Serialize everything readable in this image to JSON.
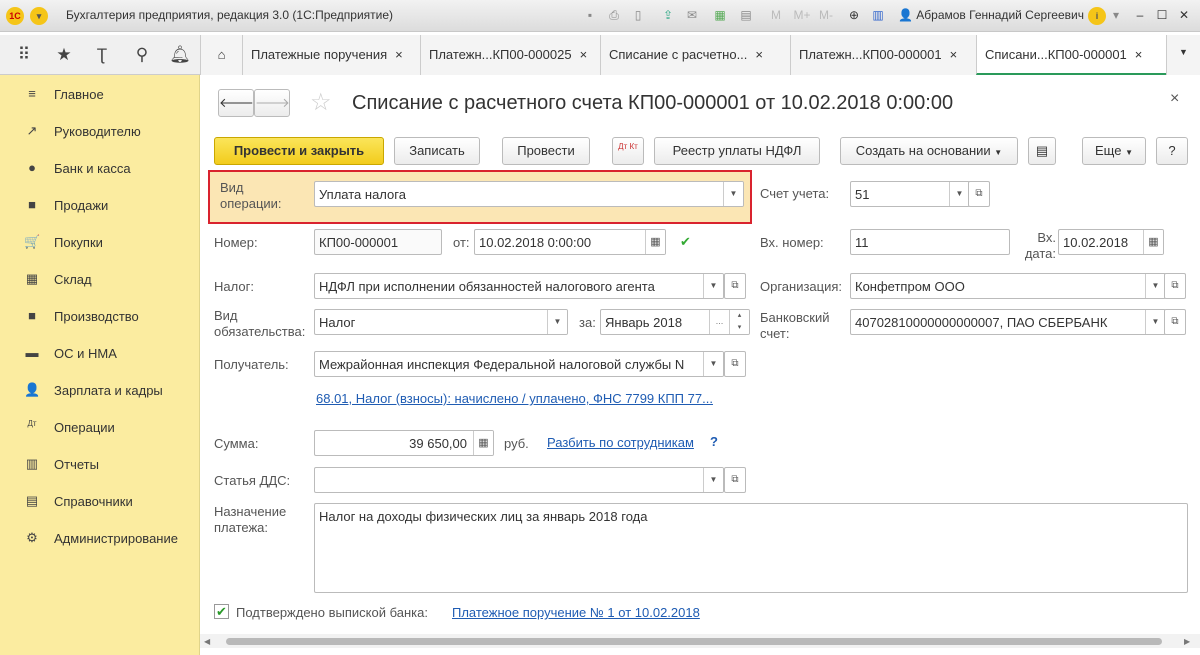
{
  "window": {
    "title": "Бухгалтерия предприятия, редакция 3.0 (1С:Предприятие)",
    "user": "Абрамов Геннадий Сергеевич",
    "logo": "1С"
  },
  "tabs": [
    {
      "label": "Платежные поручения"
    },
    {
      "label": "Платежн...КП00-000025"
    },
    {
      "label": "Списание с расчетно..."
    },
    {
      "label": "Платежн...КП00-000001"
    },
    {
      "label": "Списани...КП00-000001"
    }
  ],
  "sidebar": {
    "items": [
      {
        "label": "Главное",
        "icon": "≡"
      },
      {
        "label": "Руководителю",
        "icon": "↗"
      },
      {
        "label": "Банк и касса",
        "icon": "●"
      },
      {
        "label": "Продажи",
        "icon": "■"
      },
      {
        "label": "Покупки",
        "icon": "🛒"
      },
      {
        "label": "Склад",
        "icon": "▦"
      },
      {
        "label": "Производство",
        "icon": "■"
      },
      {
        "label": "ОС и НМА",
        "icon": "▬"
      },
      {
        "label": "Зарплата и кадры",
        "icon": "👤"
      },
      {
        "label": "Операции",
        "icon": "Дт"
      },
      {
        "label": "Отчеты",
        "icon": "▥"
      },
      {
        "label": "Справочники",
        "icon": "▤"
      },
      {
        "label": "Администрирование",
        "icon": "⚙"
      }
    ]
  },
  "doc": {
    "title": "Списание с расчетного счета КП00-000001 от 10.02.2018 0:00:00",
    "toolbar": {
      "post_close": "Провести и закрыть",
      "save": "Записать",
      "post": "Провести",
      "dtkt": "Дт Кт",
      "registry": "Реестр уплаты НДФЛ",
      "create_based": "Создать на основании",
      "more": "Еще",
      "help": "?"
    },
    "op_type": {
      "label": "Вид операции:",
      "value": "Уплата налога"
    },
    "account": {
      "label": "Счет учета:",
      "value": "51"
    },
    "number": {
      "label": "Номер:",
      "value": "КП00-000001",
      "from_label": "от:",
      "date": "10.02.2018  0:00:00"
    },
    "in_number": {
      "label": "Вх. номер:",
      "value": "11",
      "date_label": "Вх. дата:",
      "date": "10.02.2018"
    },
    "tax": {
      "label": "Налог:",
      "value": "НДФЛ при исполнении обязанностей налогового агента"
    },
    "org": {
      "label": "Организация:",
      "value": "Конфетпром ООО"
    },
    "obligation": {
      "label": "Вид обязательства:",
      "value": "Налог",
      "period_label": "за:",
      "period": "Январь 2018"
    },
    "bank_account": {
      "label": "Банковский счет:",
      "value": "40702810000000000007, ПАО СБЕРБАНК"
    },
    "recipient": {
      "label": "Получатель:",
      "value": "Межрайонная инспекция Федеральной налоговой службы N"
    },
    "account_link": "68.01, Налог (взносы): начислено / уплачено, ФНС 7799 КПП 77...",
    "sum": {
      "label": "Сумма:",
      "value": "39 650,00",
      "currency": "руб.",
      "split_link": "Разбить по сотрудникам",
      "help": "?"
    },
    "dds": {
      "label": "Статья ДДС:",
      "value": ""
    },
    "purpose": {
      "label": "Назначение платежа:",
      "value": "Налог на доходы физических лиц за январь 2018 года"
    },
    "confirmed": {
      "label": "Подтверждено выпиской банка:",
      "checked": true,
      "link": "Платежное поручение № 1 от 10.02.2018"
    }
  }
}
